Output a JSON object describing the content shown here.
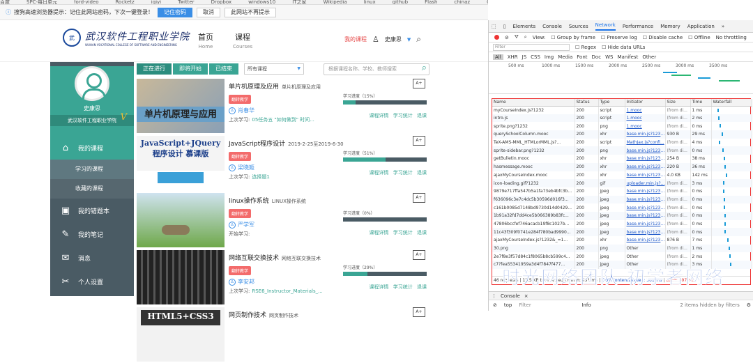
{
  "bookmarks": [
    "百度",
    "SPC-每日单元",
    "ford-video",
    "Rocketz",
    "iqiyi",
    "Twitter",
    "Dropbox",
    "windows10",
    "IT之家",
    "Wikipedia",
    "linux",
    "github",
    "Flash",
    "chinaz",
    "Gmail"
  ],
  "savebar": {
    "message": "搜狗高速浏览器提示：记住此网站密码，下次一键登录！",
    "remember": "记住密码",
    "cancel": "取消",
    "never": "此网站不再提示"
  },
  "header": {
    "logo_name": "武汉软件工程职业学院",
    "logo_sub": "WUHAN VOCATIONAL COLLEGE OF SOFTWARE AND ENGINEERING",
    "nav": [
      {
        "label": "首页",
        "sub": "Home"
      },
      {
        "label": "课程",
        "sub": "Courses"
      }
    ],
    "my_course": "我的课程",
    "user": "史康思"
  },
  "sidebar": {
    "user": "史康思",
    "vip": "V",
    "school": "武汉软件工程职业学院",
    "items": [
      {
        "label": "我的课程",
        "icon": "course-icon"
      },
      {
        "label": "我的错题本",
        "icon": "board-icon"
      },
      {
        "label": "我的笔记",
        "icon": "pen-icon"
      },
      {
        "label": "消息",
        "icon": "message-icon"
      },
      {
        "label": "个人设置",
        "icon": "settings-icon"
      }
    ],
    "subitems": [
      "学习的课程",
      "收藏的课程"
    ]
  },
  "filters": {
    "tabs": [
      "正在进行",
      "即将开始",
      "已结束"
    ],
    "select": "所有课程",
    "search_placeholder": "根据课程名称、学校、教师搜索"
  },
  "courses": [
    {
      "title": "单片机原理及应用",
      "sub": "单片机原理及应用",
      "pill": "翻转教学",
      "teacher": "肖春华",
      "last_label": "上次学习:",
      "last": "05任务五 \"如何做到\" 时间...",
      "progress_label": "学习进度（15%）",
      "progress": 15,
      "thumb": "单片机原理与应用"
    },
    {
      "title": "JavaScript程序设计",
      "sub": "2019-2-25至2019-6-30",
      "pill": "翻转教学",
      "teacher": "梁晓姬",
      "last_label": "上次学习:",
      "last": "选择题1",
      "progress_label": "学习进度（51%）",
      "progress": 51,
      "thumb": "JavaScript+JQuery 程序设计 慕课版"
    },
    {
      "title": "linux操作系统",
      "sub": "LINUX操作系统",
      "pill": "翻转教学",
      "teacher": "严学军",
      "last_label": "开始学习:",
      "last": "",
      "progress_label": "学习进度（0%）",
      "progress": 0,
      "thumb": "linux"
    },
    {
      "title": "网络互联交换技术",
      "sub": "网络互联交换技术",
      "pill": "翻转教学",
      "teacher": "李安邦",
      "last_label": "上次学习:",
      "last": "RSE6_Instructor_Materials_...",
      "progress_label": "学习进度（29%）",
      "progress": 29,
      "thumb": "server"
    },
    {
      "title": "网页制作技术",
      "sub": "网页制作技术",
      "pill": "",
      "teacher": "",
      "last_label": "",
      "last": "",
      "progress_label": "",
      "progress": null,
      "thumb": "HTML5+CSS3"
    }
  ],
  "course_links": [
    "课程详情",
    "学习统计",
    "退课"
  ],
  "devtools": {
    "tabs": [
      "Elements",
      "Console",
      "Sources",
      "Network",
      "Performance",
      "Memory",
      "Application",
      "»"
    ],
    "toolbar": [
      "View:",
      "Group by frame",
      "Preserve log",
      "Disable cache",
      "Offline",
      "No throttling"
    ],
    "filter_placeholder": "Filter",
    "filter_opts": [
      "Regex",
      "Hide data URLs"
    ],
    "types": [
      "All",
      "XHR",
      "JS",
      "CSS",
      "Img",
      "Media",
      "Font",
      "Doc",
      "WS",
      "Manifest",
      "Other"
    ],
    "ticks": [
      "500 ms",
      "1000 ms",
      "1500 ms",
      "2000 ms",
      "2500 ms",
      "3000 ms",
      "3500 ms"
    ],
    "columns": [
      "Name",
      "Status",
      "Type",
      "Initiator",
      "Size",
      "Time",
      "Waterfall"
    ],
    "rows": [
      [
        "myCourseIndex.js?1232",
        "200",
        "script",
        "1.mooc",
        "(from di...",
        "1 ms"
      ],
      [
        "intro.js",
        "200",
        "script",
        "1.mooc",
        "(from di...",
        "2 ms"
      ],
      [
        "sprite.png?1232",
        "200",
        "png",
        "1.mooc",
        "(from di...",
        "0 ms"
      ],
      [
        "querySchoolColumn.mooc",
        "200",
        "xhr",
        "base.min.js?1232...",
        "930 B",
        "29 ms"
      ],
      [
        "TeX-AMS-MML_HTMLorMML.js?...",
        "200",
        "script",
        "MathJax.js?confi...",
        "(from di...",
        "4 ms"
      ],
      [
        "sprite-sidebar.png?1232",
        "200",
        "png",
        "base.min.js?1232...",
        "(from di...",
        "0 ms"
      ],
      [
        "getBulletin.mooc",
        "200",
        "xhr",
        "base.min.js?1232...",
        "254 B",
        "38 ms"
      ],
      [
        "hasmessage.mooc",
        "200",
        "xhr",
        "base.min.js?1232...",
        "220 B",
        "36 ms"
      ],
      [
        "ajaxMyCourseIndex.mooc",
        "200",
        "xhr",
        "base.min.js?1232...",
        "4.0 KB",
        "142 ms"
      ],
      [
        "icon-loading.gif?1232",
        "200",
        "gif",
        "uploader.min.js?...",
        "(from di...",
        "3 ms"
      ],
      [
        "9879e717ffa547b5a1fa73eb4bfc3b...",
        "200",
        "jpeg",
        "base.min.js?1232...",
        "(from di...",
        "0 ms"
      ],
      [
        "f636096c3e7c4dc5b30596d016f3...",
        "200",
        "jpeg",
        "base.min.js?1232...",
        "(from di...",
        "0 ms"
      ],
      [
        "c161b0085d7148bd9730d14d0429...",
        "200",
        "jpeg",
        "base.min.js?1232...",
        "(from di...",
        "0 ms"
      ],
      [
        "1b91a32fd7dd4ce5b066389b83fc...",
        "200",
        "jpeg",
        "base.min.js?1232...",
        "(from di...",
        "0 ms"
      ],
      [
        "47806bccfef746acacb19f8c1027b...",
        "200",
        "jpeg",
        "base.min.js?1232...",
        "(from di...",
        "0 ms"
      ],
      [
        "11c43f309f0741e284f780bad9990...",
        "200",
        "jpeg",
        "base.min.js?1232...",
        "(from di...",
        "0 ms"
      ],
      [
        "ajaxMyCourseIndex.js?1232&_=1...",
        "200",
        "xhr",
        "base.min.js?1232...",
        "876 B",
        "7 ms"
      ],
      [
        "30.png",
        "200",
        "png",
        "Other",
        "(from di...",
        "1 ms"
      ],
      [
        "2e7f8e3f57d84c1f8065b8cb599c4...",
        "200",
        "jpeg",
        "Other",
        "(from di...",
        "2 ms"
      ],
      [
        "c7?fea55341959a3d4f7847f477...",
        "200",
        "jpeg",
        "Other",
        "(from di...",
        "3 ms"
      ]
    ],
    "status": {
      "requests": "46 requests",
      "transferred": "13.5 KB transferred",
      "finish": "Finish: 491 ms",
      "dcl": "DOMContentLoaded: 361 ms",
      "load": "Load: 497 ms"
    },
    "console_tab": "Console",
    "console_context": "top",
    "console_filter": "Filter",
    "console_level": "Info",
    "hidden": "2 items hidden by filters"
  },
  "watermark": "时光网络团队 初学者网络"
}
